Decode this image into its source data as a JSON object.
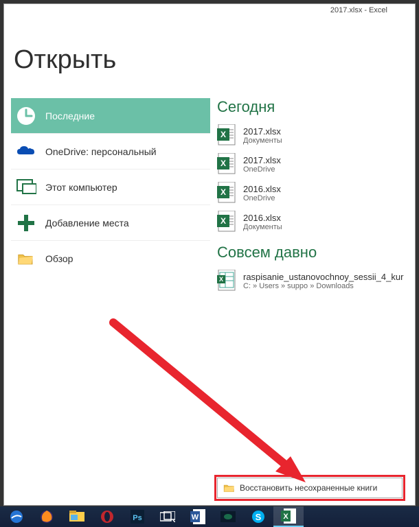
{
  "titlebar": "2017.xlsx - Excel",
  "page_title": "Открыть",
  "sidebar": {
    "items": [
      {
        "label": "Последние",
        "icon": "clock",
        "selected": true
      },
      {
        "label": "OneDrive: персональный",
        "icon": "onedrive",
        "selected": false
      },
      {
        "label": "Этот компьютер",
        "icon": "computer",
        "selected": false
      },
      {
        "label": "Добавление места",
        "icon": "plus",
        "selected": false
      },
      {
        "label": "Обзор",
        "icon": "folder",
        "selected": false
      }
    ]
  },
  "sections": [
    {
      "title": "Сегодня",
      "files": [
        {
          "name": "2017.xlsx",
          "path": "Документы",
          "type": "xlsx"
        },
        {
          "name": "2017.xlsx",
          "path": "OneDrive",
          "type": "xlsx"
        },
        {
          "name": "2016.xlsx",
          "path": "OneDrive",
          "type": "xlsx"
        },
        {
          "name": "2016.xlsx",
          "path": "Документы",
          "type": "xlsx"
        }
      ]
    },
    {
      "title": "Совсем давно",
      "files": [
        {
          "name": "raspisanie_ustanovochnoy_sessii_4_kur",
          "path": "C: » Users » suppo » Downloads",
          "type": "xls"
        }
      ]
    }
  ],
  "recover_button": "Восстановить несохраненные книги",
  "taskbar": {
    "items": [
      {
        "name": "edge"
      },
      {
        "name": "firefox"
      },
      {
        "name": "file-explorer"
      },
      {
        "name": "opera"
      },
      {
        "name": "photoshop"
      },
      {
        "name": "task-view"
      },
      {
        "name": "word"
      },
      {
        "name": "app"
      },
      {
        "name": "skype"
      },
      {
        "name": "excel",
        "active": true
      }
    ]
  },
  "colors": {
    "excel_green": "#217346",
    "sidebar_selected": "#6bc0a7",
    "arrow_red": "#e8252e"
  }
}
